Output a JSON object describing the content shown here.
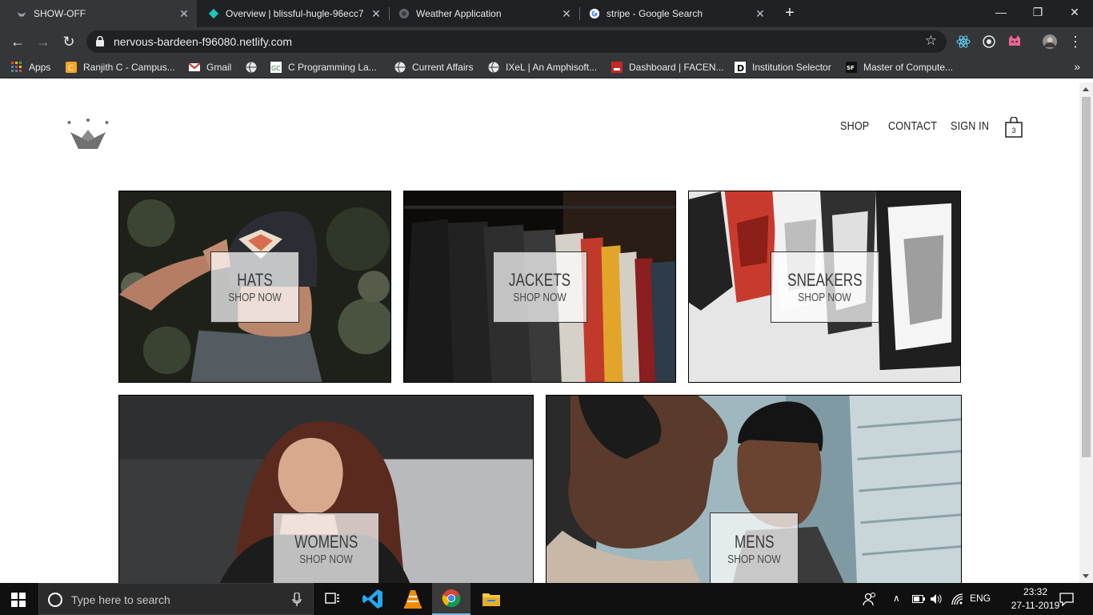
{
  "browser": {
    "tabs": [
      {
        "title": "SHOW-OFF",
        "active": true,
        "favicon": "crown-icon"
      },
      {
        "title": "Overview | blissful-hugle-96ecc7",
        "active": false,
        "favicon": "netlify-icon"
      },
      {
        "title": "Weather Application",
        "active": false,
        "favicon": "globe-icon"
      },
      {
        "title": "stripe - Google Search",
        "active": false,
        "favicon": "google-icon"
      }
    ],
    "url": "nervous-bardeen-f96080.netlify.com",
    "bookmarks": [
      {
        "label": "Apps",
        "icon": "apps-grid-icon"
      },
      {
        "label": "Ranjith C - Campus...",
        "icon": "campus-icon"
      },
      {
        "label": "Gmail",
        "icon": "gmail-icon"
      },
      {
        "label": "",
        "icon": "globe-icon"
      },
      {
        "label": "C Programming La...",
        "icon": "c-programming-icon"
      },
      {
        "label": "Current Affairs",
        "icon": "globe-icon"
      },
      {
        "label": "IXeL | An Amphisoft...",
        "icon": "globe-icon"
      },
      {
        "label": "Dashboard | FACEN...",
        "icon": "facenet-icon"
      },
      {
        "label": "Institution Selector",
        "icon": "institution-icon"
      },
      {
        "label": "Master of Compute...",
        "icon": "sf-icon"
      }
    ]
  },
  "site": {
    "nav": {
      "shop": "SHOP",
      "contact": "CONTACT",
      "signin": "SIGN IN",
      "cart_count": "3"
    },
    "categories": [
      {
        "title": "HATS",
        "subtitle": "SHOP NOW"
      },
      {
        "title": "JACKETS",
        "subtitle": "SHOP NOW"
      },
      {
        "title": "SNEAKERS",
        "subtitle": "SHOP NOW"
      },
      {
        "title": "WOMENS",
        "subtitle": "SHOP NOW"
      },
      {
        "title": "MENS",
        "subtitle": "SHOP NOW"
      }
    ]
  },
  "taskbar": {
    "search_placeholder": "Type here to search",
    "language": "ENG",
    "time": "23:32",
    "date": "27-11-2019"
  }
}
